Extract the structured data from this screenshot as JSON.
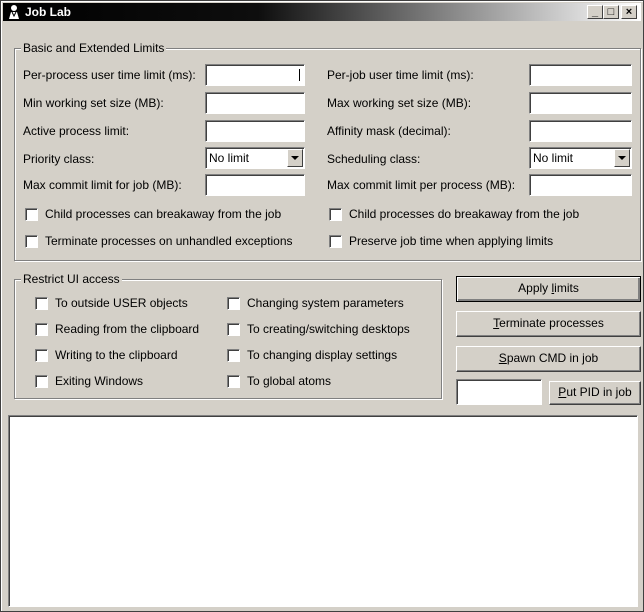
{
  "window": {
    "title": "Job Lab",
    "icon": "job-lab-person-icon",
    "controls": {
      "minimize": "_",
      "maximize": "□",
      "close": "×"
    }
  },
  "limits_group": {
    "legend": "Basic and Extended Limits",
    "left": {
      "per_process_time_label": "Per-process user time limit (ms):",
      "per_process_time_value": "",
      "min_working_set_label": "Min working set size (MB):",
      "min_working_set_value": "",
      "active_process_label": "Active process limit:",
      "active_process_value": "",
      "priority_class_label": "Priority class:",
      "priority_class_value": "No limit",
      "max_commit_job_label": "Max commit limit for job (MB):",
      "max_commit_job_value": ""
    },
    "right": {
      "per_job_time_label": "Per-job user time limit (ms):",
      "per_job_time_value": "",
      "max_working_set_label": "Max working set size (MB):",
      "max_working_set_value": "",
      "affinity_label": "Affinity mask (decimal):",
      "affinity_value": "",
      "scheduling_class_label": "Scheduling class:",
      "scheduling_class_value": "No limit",
      "max_commit_process_label": "Max commit limit per process (MB):",
      "max_commit_process_value": ""
    },
    "checkboxes": {
      "child_can_breakaway": "Child processes can breakaway from the job",
      "child_do_breakaway": "Child processes do breakaway from the job",
      "terminate_unhandled": "Terminate processes on unhandled exceptions",
      "preserve_job_time": "Preserve job time when applying limits"
    }
  },
  "ui_group": {
    "legend": "Restrict UI access",
    "col1": [
      "To outside USER objects",
      "Reading from the clipboard",
      "Writing to the clipboard",
      "Exiting Windows"
    ],
    "col2": [
      "Changing system parameters",
      "To creating/switching desktops",
      "To changing display settings",
      "To global atoms"
    ]
  },
  "buttons": {
    "apply_pre": "Apply ",
    "apply_key": "l",
    "apply_post": "imits",
    "terminate_key": "T",
    "terminate_post": "erminate processes",
    "spawn_key": "S",
    "spawn_post": "pawn CMD in job",
    "pid_key": "P",
    "pid_post": "ut PID in job"
  },
  "pid_input": {
    "value": ""
  },
  "output": {
    "text": ""
  }
}
